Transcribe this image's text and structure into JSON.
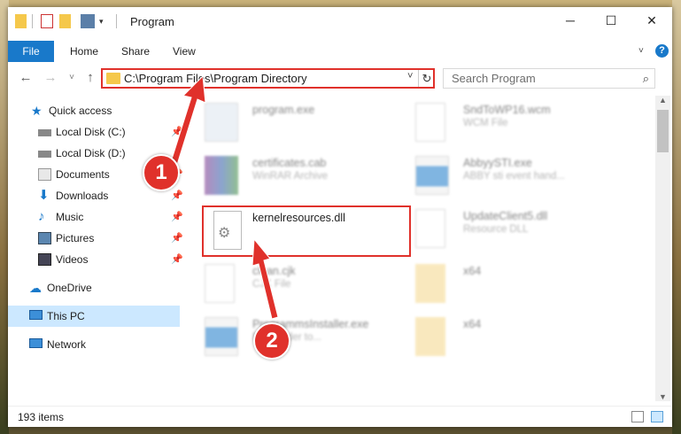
{
  "window": {
    "title": "Program"
  },
  "ribbon": {
    "tabs": [
      "File",
      "Home",
      "Share",
      "View"
    ],
    "help": "?"
  },
  "address": {
    "path": "C:\\Program Files\\Program Directory"
  },
  "search": {
    "placeholder": "Search Program"
  },
  "sidebar": {
    "items": [
      {
        "label": "Quick access",
        "icon": "star-icon"
      },
      {
        "label": "Local Disk (C:)",
        "icon": "drive-icon"
      },
      {
        "label": "Local Disk (D:)",
        "icon": "drive-icon"
      },
      {
        "label": "Documents",
        "icon": "documents-icon"
      },
      {
        "label": "Downloads",
        "icon": "download-icon"
      },
      {
        "label": "Music",
        "icon": "music-icon"
      },
      {
        "label": "Pictures",
        "icon": "pictures-icon"
      },
      {
        "label": "Videos",
        "icon": "videos-icon"
      },
      {
        "label": "OneDrive",
        "icon": "cloud-icon"
      },
      {
        "label": "This PC",
        "icon": "computer-icon"
      },
      {
        "label": "Network",
        "icon": "network-icon"
      }
    ]
  },
  "files": [
    {
      "name": "program.exe",
      "sub": ""
    },
    {
      "name": "SndToWP16.wcm",
      "sub": "WCM File"
    },
    {
      "name": "certificates.cab",
      "sub": "WinRAR Archive"
    },
    {
      "name": "AbbyySTI.exe",
      "sub": "ABBY sti event hand..."
    },
    {
      "name": "kernelresources.dll",
      "sub": ""
    },
    {
      "name": "UpdateClient5.dll",
      "sub": "Resource DLL"
    },
    {
      "name": "clean.cjk",
      "sub": "CJK File"
    },
    {
      "name": "x64",
      "sub": ""
    },
    {
      "name": "ProgrammsInstaller.exe",
      "sub": "Finereader to..."
    },
    {
      "name": "x64",
      "sub": ""
    }
  ],
  "callouts": [
    "1",
    "2"
  ],
  "status": {
    "items": "193 items"
  },
  "colors": {
    "accent": "#1979ca",
    "highlight": "#e0312b",
    "selection": "#cce8ff"
  }
}
